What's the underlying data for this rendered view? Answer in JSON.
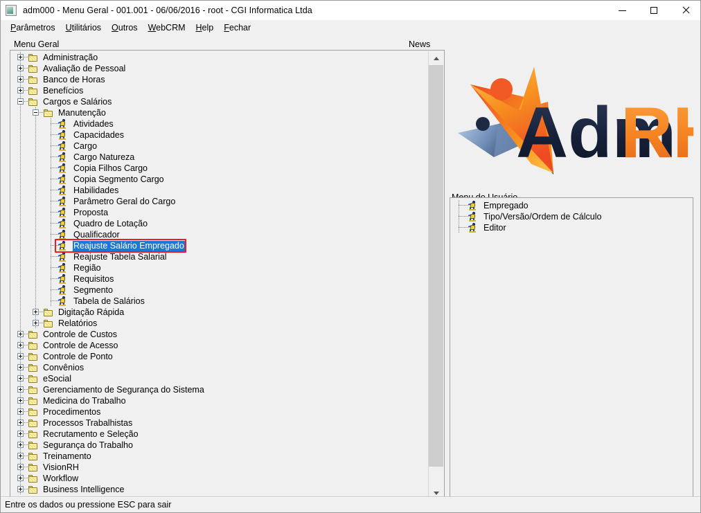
{
  "window": {
    "title": "adm000 - Menu Geral - 001.001 - 06/06/2016 - root - CGI Informatica Ltda",
    "icon": "application-icon",
    "minimize_label": "—",
    "maximize_label": "□",
    "close_label": "✕"
  },
  "menubar": {
    "items": [
      {
        "label": "Parâmetros",
        "accel": "P"
      },
      {
        "label": "Utilitários",
        "accel": "U"
      },
      {
        "label": "Outros",
        "accel": "O"
      },
      {
        "label": "WebCRM",
        "accel": "W"
      },
      {
        "label": "Help",
        "accel": "H"
      },
      {
        "label": "Fechar",
        "accel": "F"
      }
    ]
  },
  "labels": {
    "menu_geral": "Menu Geral",
    "news": "News",
    "menu_usuario": "Menu do Usuário"
  },
  "tree": {
    "selected_item": "Reajuste Salário Empregado",
    "selection_highlight_color": "#ee1c1c",
    "selection_background_color": "#1b78d6",
    "nodes": [
      {
        "label": "Administração",
        "level": 0,
        "type": "folder",
        "state": "collapsed"
      },
      {
        "label": "Avaliação de Pessoal",
        "level": 0,
        "type": "folder",
        "state": "collapsed"
      },
      {
        "label": "Banco de Horas",
        "level": 0,
        "type": "folder",
        "state": "collapsed"
      },
      {
        "label": "Benefícios",
        "level": 0,
        "type": "folder",
        "state": "collapsed"
      },
      {
        "label": "Cargos e Salários",
        "level": 0,
        "type": "folder",
        "state": "expanded"
      },
      {
        "label": "Manutenção",
        "level": 1,
        "type": "folder",
        "state": "expanded"
      },
      {
        "label": "Atividades",
        "level": 2,
        "type": "leaf"
      },
      {
        "label": "Capacidades",
        "level": 2,
        "type": "leaf"
      },
      {
        "label": "Cargo",
        "level": 2,
        "type": "leaf"
      },
      {
        "label": "Cargo Natureza",
        "level": 2,
        "type": "leaf"
      },
      {
        "label": "Copia Filhos Cargo",
        "level": 2,
        "type": "leaf"
      },
      {
        "label": "Copia Segmento Cargo",
        "level": 2,
        "type": "leaf"
      },
      {
        "label": "Habilidades",
        "level": 2,
        "type": "leaf"
      },
      {
        "label": "Parâmetro Geral do Cargo",
        "level": 2,
        "type": "leaf"
      },
      {
        "label": "Proposta",
        "level": 2,
        "type": "leaf"
      },
      {
        "label": "Quadro de Lotação",
        "level": 2,
        "type": "leaf"
      },
      {
        "label": "Qualificador",
        "level": 2,
        "type": "leaf"
      },
      {
        "label": "Reajuste Salário Empregado",
        "level": 2,
        "type": "leaf",
        "selected": true
      },
      {
        "label": "Reajuste Tabela Salarial",
        "level": 2,
        "type": "leaf"
      },
      {
        "label": "Região",
        "level": 2,
        "type": "leaf"
      },
      {
        "label": "Requisitos",
        "level": 2,
        "type": "leaf"
      },
      {
        "label": "Segmento",
        "level": 2,
        "type": "leaf"
      },
      {
        "label": "Tabela de Salários",
        "level": 2,
        "type": "leaf"
      },
      {
        "label": "Digitação Rápida",
        "level": 1,
        "type": "folder",
        "state": "collapsed"
      },
      {
        "label": "Relatórios",
        "level": 1,
        "type": "folder",
        "state": "collapsed"
      },
      {
        "label": "Controle de Custos",
        "level": 0,
        "type": "folder",
        "state": "collapsed"
      },
      {
        "label": "Controle de Acesso",
        "level": 0,
        "type": "folder",
        "state": "collapsed"
      },
      {
        "label": "Controle de Ponto",
        "level": 0,
        "type": "folder",
        "state": "collapsed"
      },
      {
        "label": "Convênios",
        "level": 0,
        "type": "folder",
        "state": "collapsed"
      },
      {
        "label": "eSocial",
        "level": 0,
        "type": "folder",
        "state": "collapsed"
      },
      {
        "label": "Gerenciamento de Segurança do Sistema",
        "level": 0,
        "type": "folder",
        "state": "collapsed"
      },
      {
        "label": "Medicina do Trabalho",
        "level": 0,
        "type": "folder",
        "state": "collapsed"
      },
      {
        "label": "Procedimentos",
        "level": 0,
        "type": "folder",
        "state": "collapsed"
      },
      {
        "label": "Processos Trabalhistas",
        "level": 0,
        "type": "folder",
        "state": "collapsed"
      },
      {
        "label": "Recrutamento e Seleção",
        "level": 0,
        "type": "folder",
        "state": "collapsed"
      },
      {
        "label": "Segurança do Trabalho",
        "level": 0,
        "type": "folder",
        "state": "collapsed"
      },
      {
        "label": "Treinamento",
        "level": 0,
        "type": "folder",
        "state": "collapsed"
      },
      {
        "label": "VisionRH",
        "level": 0,
        "type": "folder",
        "state": "collapsed"
      },
      {
        "label": "Workflow",
        "level": 0,
        "type": "folder",
        "state": "collapsed"
      },
      {
        "label": "Business Intelligence",
        "level": 0,
        "type": "folder",
        "state": "collapsed"
      }
    ]
  },
  "user_menu": {
    "items": [
      {
        "label": "Empregado"
      },
      {
        "label": "Tipo/Versão/Ordem de Cálculo"
      },
      {
        "label": "Editor"
      }
    ]
  },
  "logo": {
    "text_primary": "Adm",
    "text_secondary": "RH",
    "colors": {
      "orange_light": "#fcb040",
      "orange": "#f47c20",
      "orange_deep": "#ef4b23",
      "navy": "#1d2a44",
      "blue_steel": "#4a6896",
      "blue_light": "#8fa9cd",
      "rh_orange": "#f58220"
    }
  },
  "statusbar": {
    "text": "Entre os dados ou pressione ESC para sair"
  },
  "scrollbar": {
    "up_arrow": "scroll-up-arrow",
    "down_arrow": "scroll-down-arrow"
  }
}
